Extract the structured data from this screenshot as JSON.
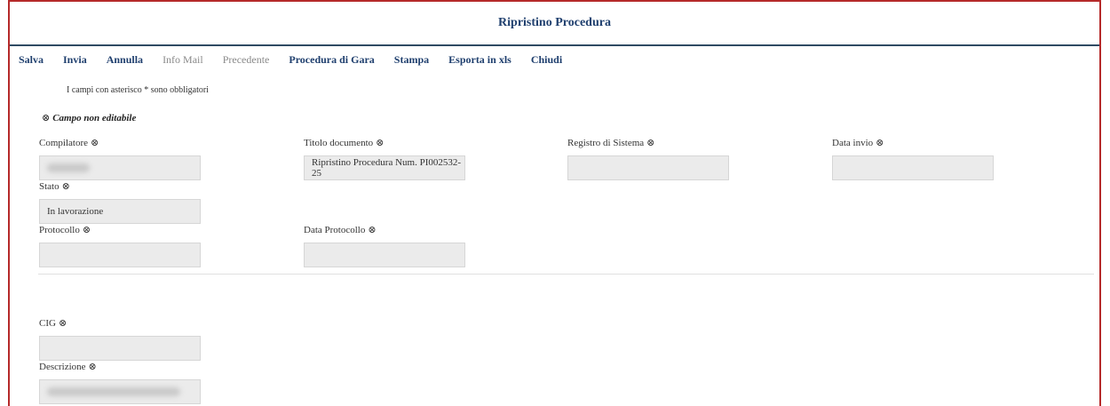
{
  "header": {
    "title": "Ripristino Procedura"
  },
  "toolbar": {
    "items": [
      {
        "label": "Salva",
        "enabled": true
      },
      {
        "label": "Invia",
        "enabled": true
      },
      {
        "label": "Annulla",
        "enabled": true
      },
      {
        "label": "Info Mail",
        "enabled": false
      },
      {
        "label": "Precedente",
        "enabled": false
      },
      {
        "label": "Procedura di Gara",
        "enabled": true
      },
      {
        "label": "Stampa",
        "enabled": true
      },
      {
        "label": "Esporta in xls",
        "enabled": true
      },
      {
        "label": "Chiudi",
        "enabled": true
      }
    ]
  },
  "form": {
    "required_note": "I campi con asterisco * sono obbligatori",
    "non_editable_legend": "Campo non editabile",
    "lock_glyph": "⊗",
    "fields": {
      "compilatore": {
        "label": "Compilatore",
        "value": ""
      },
      "titolo": {
        "label": "Titolo documento",
        "value": "Ripristino Procedura Num. PI002532-25"
      },
      "registro": {
        "label": "Registro di Sistema",
        "value": ""
      },
      "data_invio": {
        "label": "Data invio",
        "value": ""
      },
      "stato": {
        "label": "Stato",
        "value": "In lavorazione"
      },
      "protocollo": {
        "label": "Protocollo",
        "value": ""
      },
      "data_protocollo": {
        "label": "Data Protocollo",
        "value": ""
      },
      "cig": {
        "label": "CIG",
        "value": ""
      },
      "descrizione": {
        "label": "Descrizione",
        "value": ""
      }
    }
  }
}
